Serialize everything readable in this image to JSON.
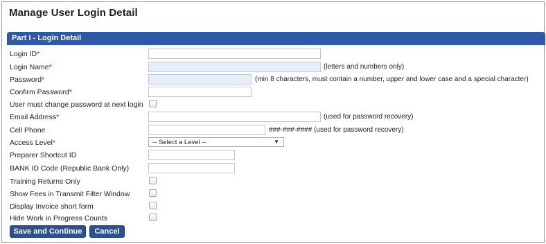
{
  "page": {
    "title": "Manage User Login Detail"
  },
  "section": {
    "title": "Part I - Login Detail"
  },
  "fields": {
    "login_id": {
      "label": "Login ID",
      "required": "*"
    },
    "login_name": {
      "label": "Login Name",
      "required": "*",
      "hint": "(letters and numbers only)"
    },
    "password": {
      "label": "Password",
      "required": "*",
      "hint": "(min 8 characters, must contain a number, upper and lower case and a special character)"
    },
    "confirm_password": {
      "label": "Confirm Password",
      "required": "*"
    },
    "must_change": {
      "label": "User must change password at next login"
    },
    "email": {
      "label": "Email Address",
      "required": "*",
      "hint": "(used for password recovery)"
    },
    "cell_phone": {
      "label": "Cell Phone",
      "hint": "###-###-#### (used for password recovery)"
    },
    "access_level": {
      "label": "Access Level",
      "required": "*",
      "selected": "-- Select a Level --"
    },
    "preparer_shortcut": {
      "label": "Preparer Shortcut ID"
    },
    "bank_id": {
      "label": "BANK ID Code (Republic Bank Only)"
    },
    "training_returns": {
      "label": "Training Returns Only"
    },
    "show_fees": {
      "label": "Show Fees in Transmit Filter Window"
    },
    "invoice_short": {
      "label": "Display Invoice short form"
    },
    "hide_wip": {
      "label": "Hide Work in Progress Counts"
    }
  },
  "buttons": {
    "save": "Save and Continue",
    "cancel": "Cancel"
  },
  "icons": {
    "dropdown_arrow": "▼"
  },
  "colors": {
    "section_bar": "#2f58a6",
    "button": "#2c4f95",
    "required": "#d01818",
    "autofill_input": "#e6eefb"
  }
}
